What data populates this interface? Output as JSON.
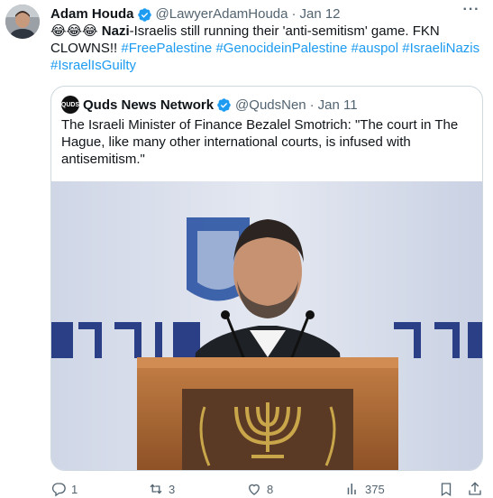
{
  "tweet": {
    "author_name": "Adam Houda",
    "author_handle": "@LawyerAdamHouda",
    "separator": "·",
    "date": "Jan 12",
    "more_icon": "more-icon",
    "text": {
      "emojis": "😂😂😂",
      "bold_word": "Nazi",
      "line1_rest": "-Israelis still running their 'anti-semitism' game. FKN",
      "line2_plain": "CLOWNS!!",
      "hashtags_line2": [
        "#FreePalestine",
        "#GenocideinPalestine",
        "#auspol",
        "#IsraeliNazis"
      ],
      "hashtags_line3": [
        "#IsraelIsGuilty"
      ]
    }
  },
  "quoted": {
    "avatar_text": "QUDS",
    "author_name": "Quds News Network",
    "author_handle": "@QudsNen",
    "separator": "·",
    "date": "Jan 11",
    "text_lines": [
      "The Israeli Minister of Finance Bezalel Smotrich: \"The court in The",
      "Hague, like many other international courts, is infused with",
      "antisemitism.\""
    ]
  },
  "actions": {
    "reply_count": "1",
    "retweet_count": "3",
    "like_count": "8",
    "views_count": "375"
  },
  "colors": {
    "accent": "#1d9bf0",
    "secondary_text": "#536471",
    "border": "#cfd9de"
  }
}
